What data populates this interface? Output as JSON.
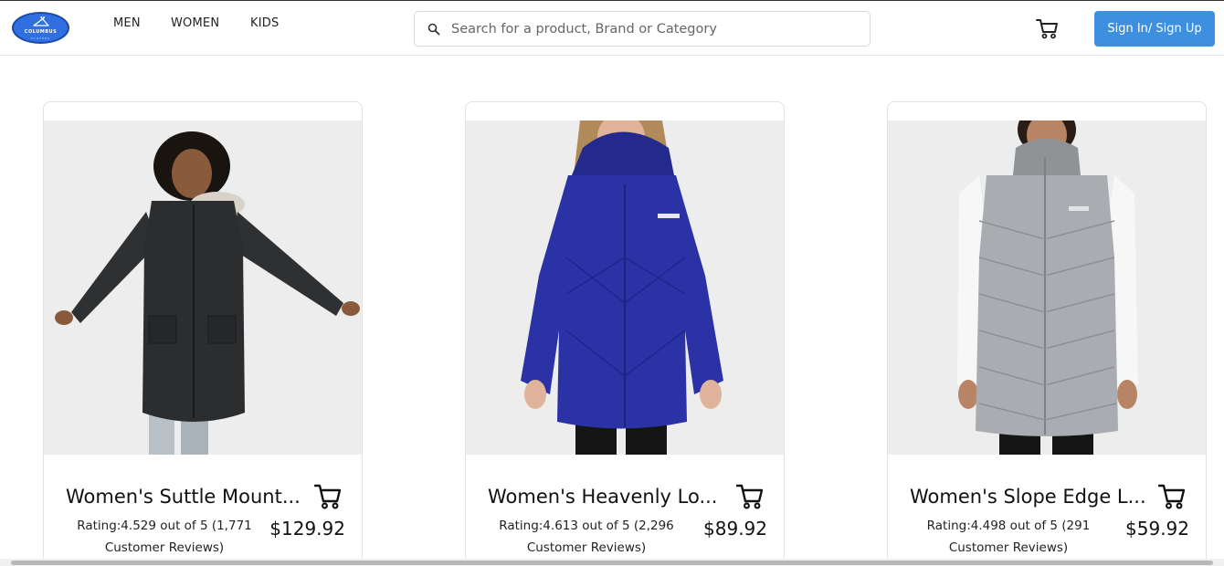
{
  "brand": {
    "logo_text": "COLUMBUS",
    "logo_sub": "CLOTHES",
    "logo_icon": "hanger-icon"
  },
  "nav": {
    "links": [
      "MEN",
      "WOMEN",
      "KIDS"
    ]
  },
  "search": {
    "placeholder": "Search for a product, Brand or Category",
    "icon": "search-icon"
  },
  "header": {
    "cart_icon": "cart-icon",
    "signin_label": "Sign In/ Sign Up"
  },
  "colors": {
    "accent": "#3d8fdf",
    "logo": "#2f6fe0",
    "image_bg": "#ededed"
  },
  "products": [
    {
      "title": "Women's Suttle Mount...",
      "rating_line1": "Rating:4.529 out of 5 (1,771",
      "rating_line2": "Customer Reviews)",
      "price": "$129.92",
      "image": "black parka jacket with fur hood"
    },
    {
      "title": "Women's Heavenly Lo...",
      "rating_line1": "Rating:4.613 out of 5 (2,296",
      "rating_line2": "Customer Reviews)",
      "price": "$89.92",
      "image": "navy blue long quilted jacket"
    },
    {
      "title": "Women's Slope Edge L...",
      "rating_line1": "Rating:4.498 out of 5 (291",
      "rating_line2": "Customer Reviews)",
      "price": "$59.92",
      "image": "grey long puffer vest"
    }
  ]
}
